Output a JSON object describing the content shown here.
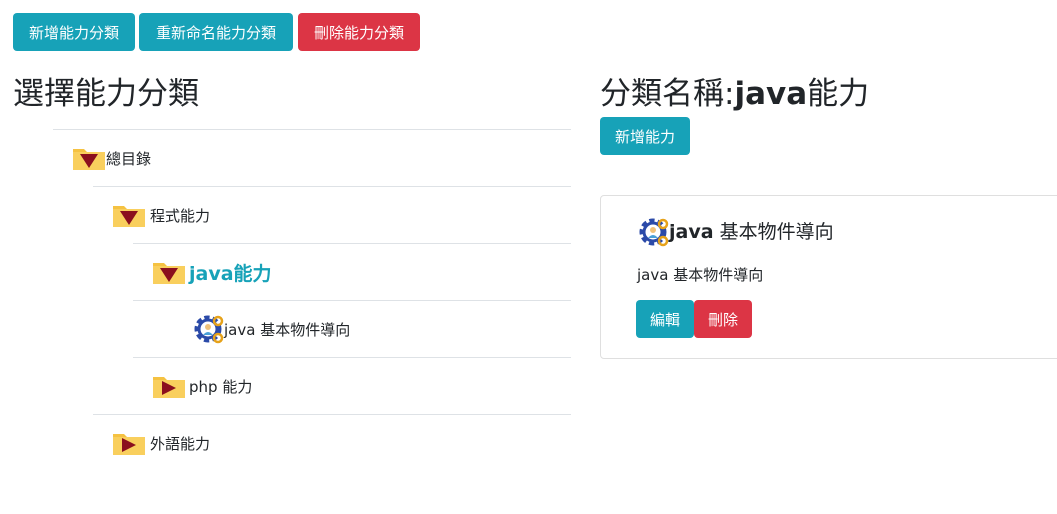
{
  "toolbar": {
    "add_category": "新增能力分類",
    "rename_category": "重新命名能力分類",
    "delete_category": "刪除能力分類"
  },
  "left_panel": {
    "title": "選擇能力分類"
  },
  "tree": {
    "items": [
      {
        "label": "總目錄",
        "icon": "folder-open-icon",
        "level": 0
      },
      {
        "label": "程式能力",
        "icon": "folder-open-icon",
        "level": 1
      },
      {
        "label": "java能力",
        "icon": "folder-open-icon",
        "level": 2,
        "selected": true
      },
      {
        "label": "java 基本物件導向",
        "icon": "gear-user-icon",
        "level": 3
      },
      {
        "label": "php 能力",
        "icon": "folder-closed-icon",
        "level": 2
      },
      {
        "label": "外語能力",
        "icon": "folder-closed-icon",
        "level": 1
      }
    ]
  },
  "right_panel": {
    "title_prefix": "分類名稱:",
    "title_name": "java",
    "title_suffix": "能力",
    "add_skill": "新增能力"
  },
  "card": {
    "title_bold": "java",
    "title_rest": " 基本物件導向",
    "text": "java 基本物件導向",
    "edit": "編輯",
    "delete": "刪除"
  },
  "colors": {
    "info": "#17a2b8",
    "danger": "#dc3545",
    "folder": "#f5c242",
    "triangle": "#8b0f1e"
  }
}
